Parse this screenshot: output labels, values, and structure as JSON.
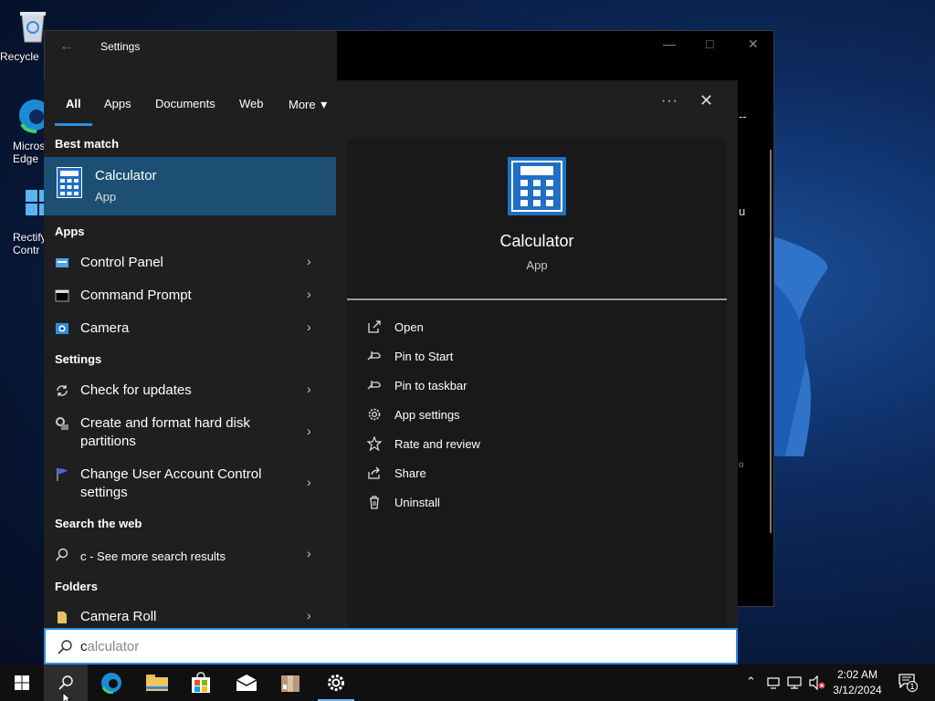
{
  "desktop": {
    "icons": [
      {
        "label": "Recycle"
      },
      {
        "label": "Micros\nEdge"
      },
      {
        "label": "Rectify\nContr"
      }
    ]
  },
  "settings_window": {
    "title": "Settings",
    "fragments": [
      "--",
      "u",
      "o"
    ]
  },
  "search": {
    "tabs": [
      {
        "label": "All"
      },
      {
        "label": "Apps"
      },
      {
        "label": "Documents"
      },
      {
        "label": "Web"
      },
      {
        "label": "More"
      }
    ],
    "more_glyph": "▾",
    "options_glyph": "···",
    "close_glyph": "✕",
    "best_match": {
      "section": "Best match",
      "name": "Calculator",
      "kind": "App"
    },
    "apps": {
      "section": "Apps",
      "items": [
        {
          "label": "Control Panel"
        },
        {
          "label": "Command Prompt"
        },
        {
          "label": "Camera"
        }
      ]
    },
    "settings": {
      "section": "Settings",
      "items": [
        {
          "label": "Check for updates"
        },
        {
          "label": "Create and format hard disk partitions"
        },
        {
          "label": "Change User Account Control settings"
        }
      ]
    },
    "web": {
      "section": "Search the web",
      "query": "c",
      "suffix": " - See more search results"
    },
    "folders": {
      "section": "Folders",
      "items": [
        {
          "label": "Camera Roll"
        }
      ]
    },
    "chevron": "›",
    "preview": {
      "name": "Calculator",
      "kind": "App",
      "actions": [
        {
          "label": "Open",
          "icon": "open-icon"
        },
        {
          "label": "Pin to Start",
          "icon": "pin-icon"
        },
        {
          "label": "Pin to taskbar",
          "icon": "pin-icon"
        },
        {
          "label": "App settings",
          "icon": "gear-icon"
        },
        {
          "label": "Rate and review",
          "icon": "star-icon"
        },
        {
          "label": "Share",
          "icon": "share-icon"
        },
        {
          "label": "Uninstall",
          "icon": "trash-icon"
        }
      ]
    },
    "input": {
      "typed": "c",
      "autocomplete": "alculator"
    }
  },
  "taskbar": {
    "clock_time": "2:02 AM",
    "clock_date": "3/12/2024",
    "notification_count": "1"
  },
  "colors": {
    "accent": "#2b8ee6",
    "selected": "#1c4f73",
    "panel": "#1f1f1f"
  }
}
